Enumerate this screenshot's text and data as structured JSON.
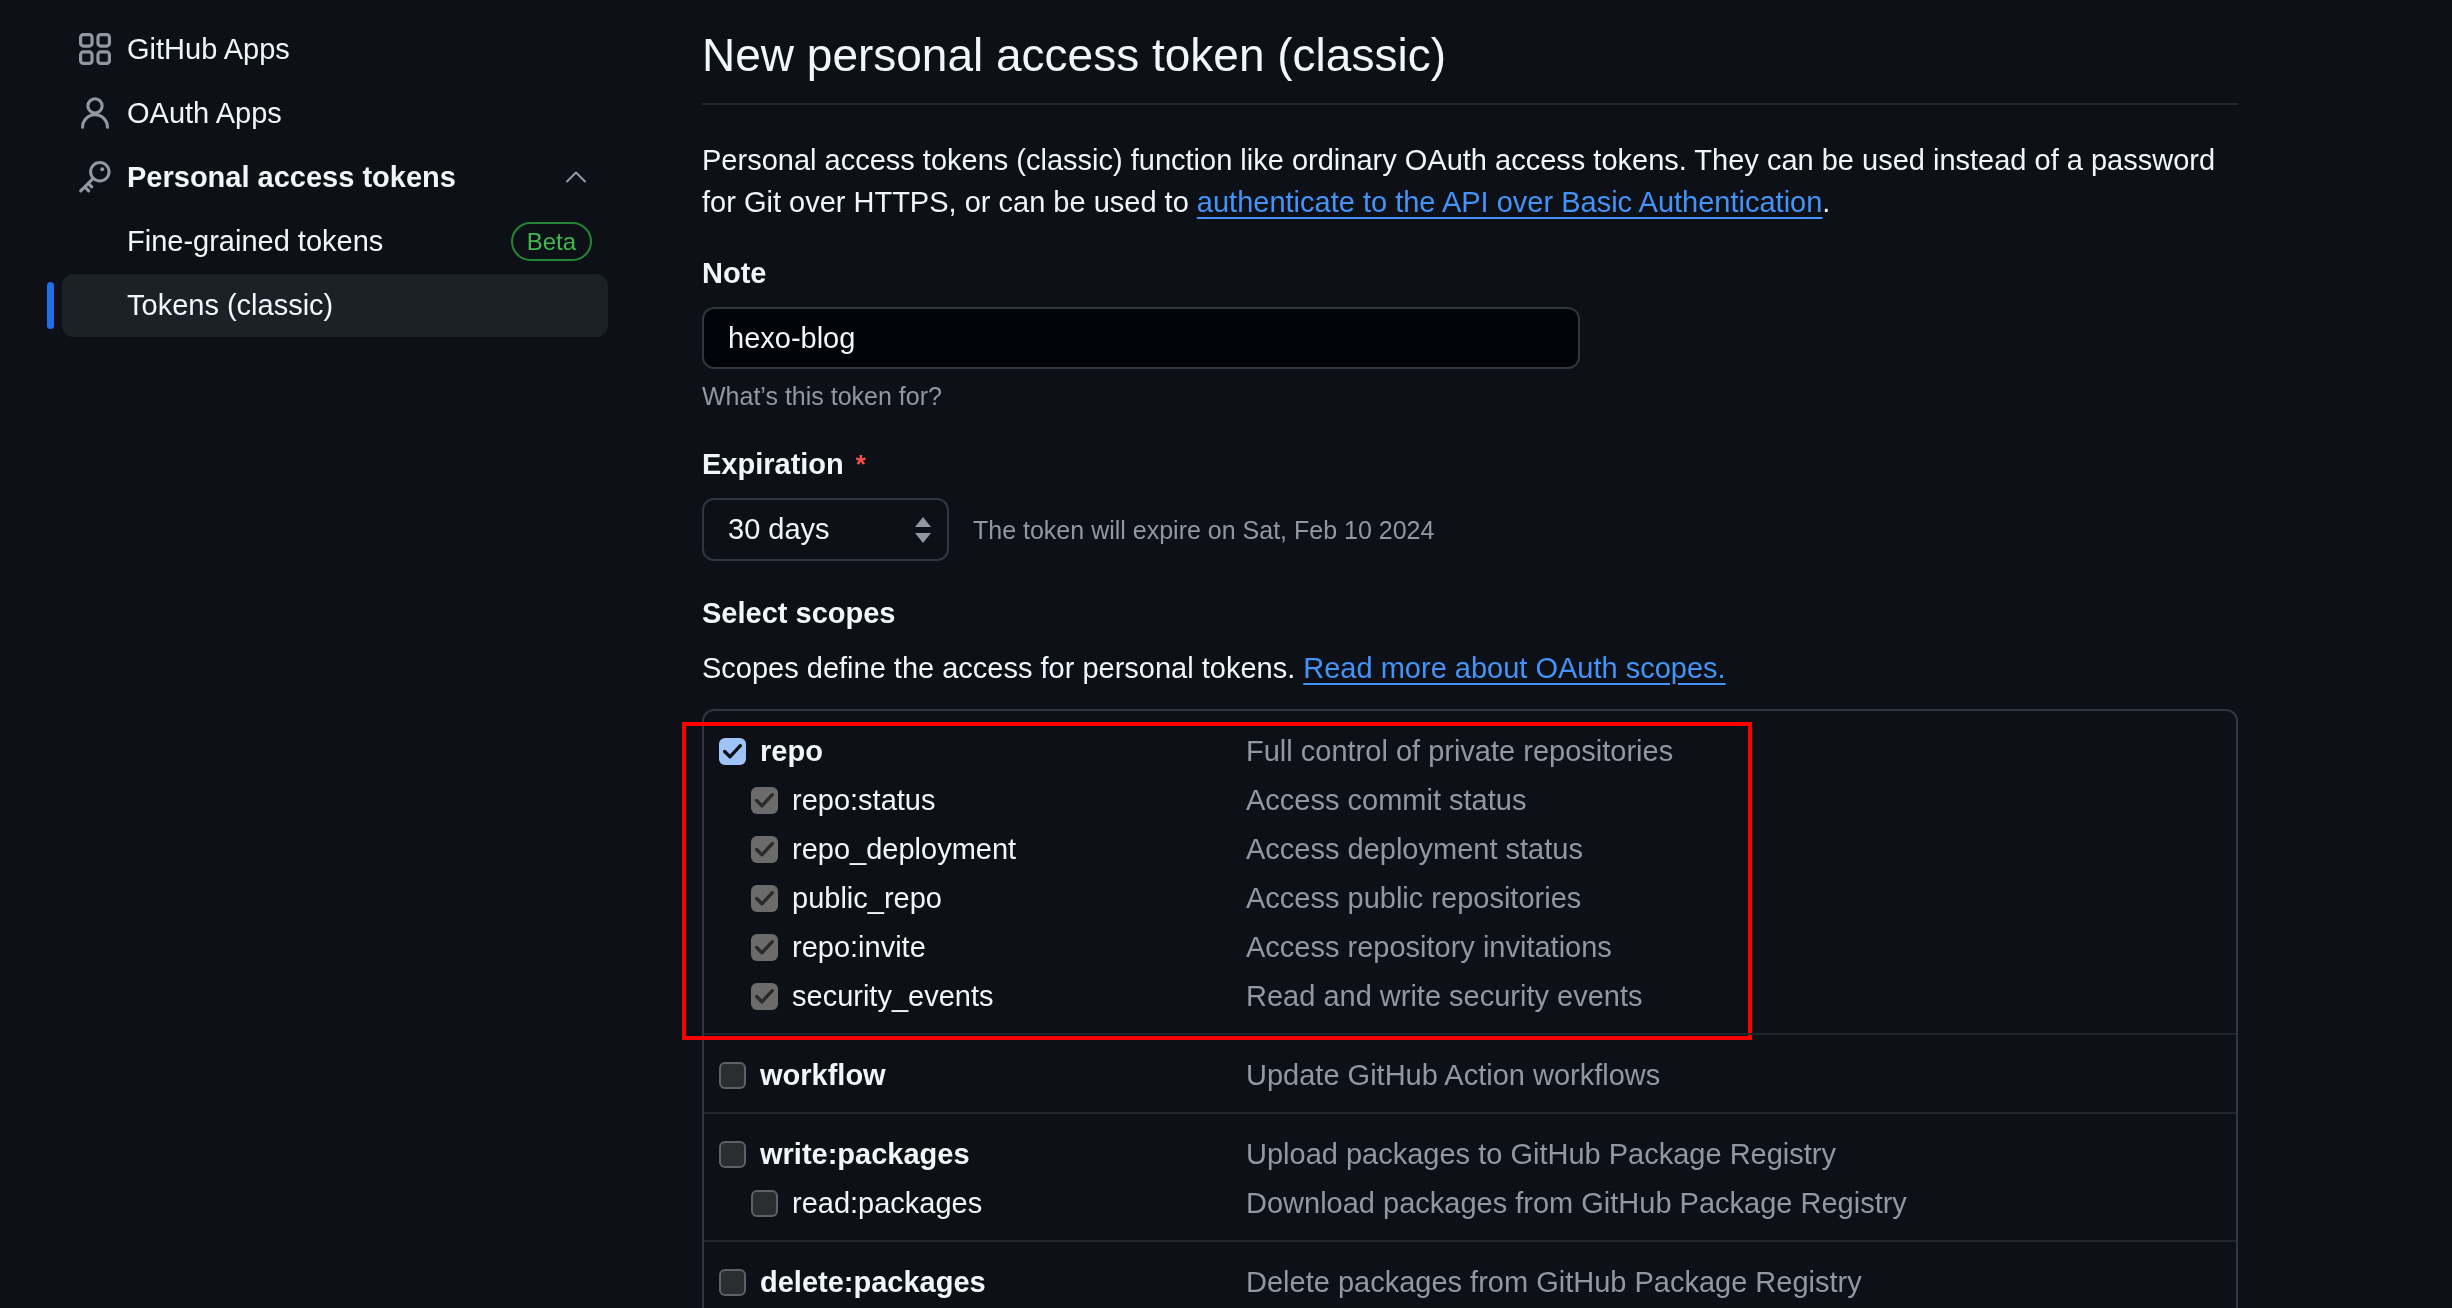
{
  "sidebar": {
    "items": [
      {
        "label": "GitHub Apps",
        "selected": false
      },
      {
        "label": "OAuth Apps",
        "selected": false
      },
      {
        "label": "Personal access tokens",
        "selected": false,
        "expanded": true,
        "children": [
          {
            "label": "Fine-grained tokens",
            "selected": false,
            "badge": "Beta"
          },
          {
            "label": "Tokens (classic)",
            "selected": true
          }
        ]
      }
    ]
  },
  "page": {
    "title": "New personal access token (classic)",
    "intro": {
      "text": "Personal access tokens (classic) function like ordinary OAuth access tokens. They can be used instead of a password for Git over HTTPS, or can be used to",
      "link": "authenticate to the API over Basic Authentication",
      "end": "."
    }
  },
  "note": {
    "label": "Note",
    "value": "hexo-blog",
    "help_text": "What’s this token for?"
  },
  "expiration": {
    "label": "Expiration",
    "required_mark": "*",
    "value": "30 days",
    "help_text": "The token will expire on Sat, Feb 10 2024"
  },
  "scopes": {
    "title": "Select scopes",
    "intro": "Scopes define the access for personal tokens.",
    "link": "Read more about OAuth scopes.",
    "groups": [
      {
        "highlighted": true,
        "name": "repo",
        "description": "Full control of private repositories",
        "checked": true,
        "disabled": false,
        "children": [
          {
            "name": "repo:status",
            "description": "Access commit status",
            "checked": true,
            "disabled": true
          },
          {
            "name": "repo_deployment",
            "description": "Access deployment status",
            "checked": true,
            "disabled": true
          },
          {
            "name": "public_repo",
            "description": "Access public repositories",
            "checked": true,
            "disabled": true
          },
          {
            "name": "repo:invite",
            "description": "Access repository invitations",
            "checked": true,
            "disabled": true
          },
          {
            "name": "security_events",
            "description": "Read and write security events",
            "checked": true,
            "disabled": true
          }
        ]
      },
      {
        "highlighted": false,
        "name": "workflow",
        "description": "Update GitHub Action workflows",
        "checked": false,
        "disabled": false
      },
      {
        "highlighted": false,
        "name": "write:packages",
        "description": "Upload packages to GitHub Package Registry",
        "checked": false,
        "disabled": false,
        "children": [
          {
            "name": "read:packages",
            "description": "Download packages from GitHub Package Registry",
            "checked": false,
            "disabled": false
          }
        ]
      },
      {
        "highlighted": false,
        "name": "delete:packages",
        "description": "Delete packages from GitHub Package Registry",
        "checked": false,
        "disabled": false
      }
    ]
  }
}
